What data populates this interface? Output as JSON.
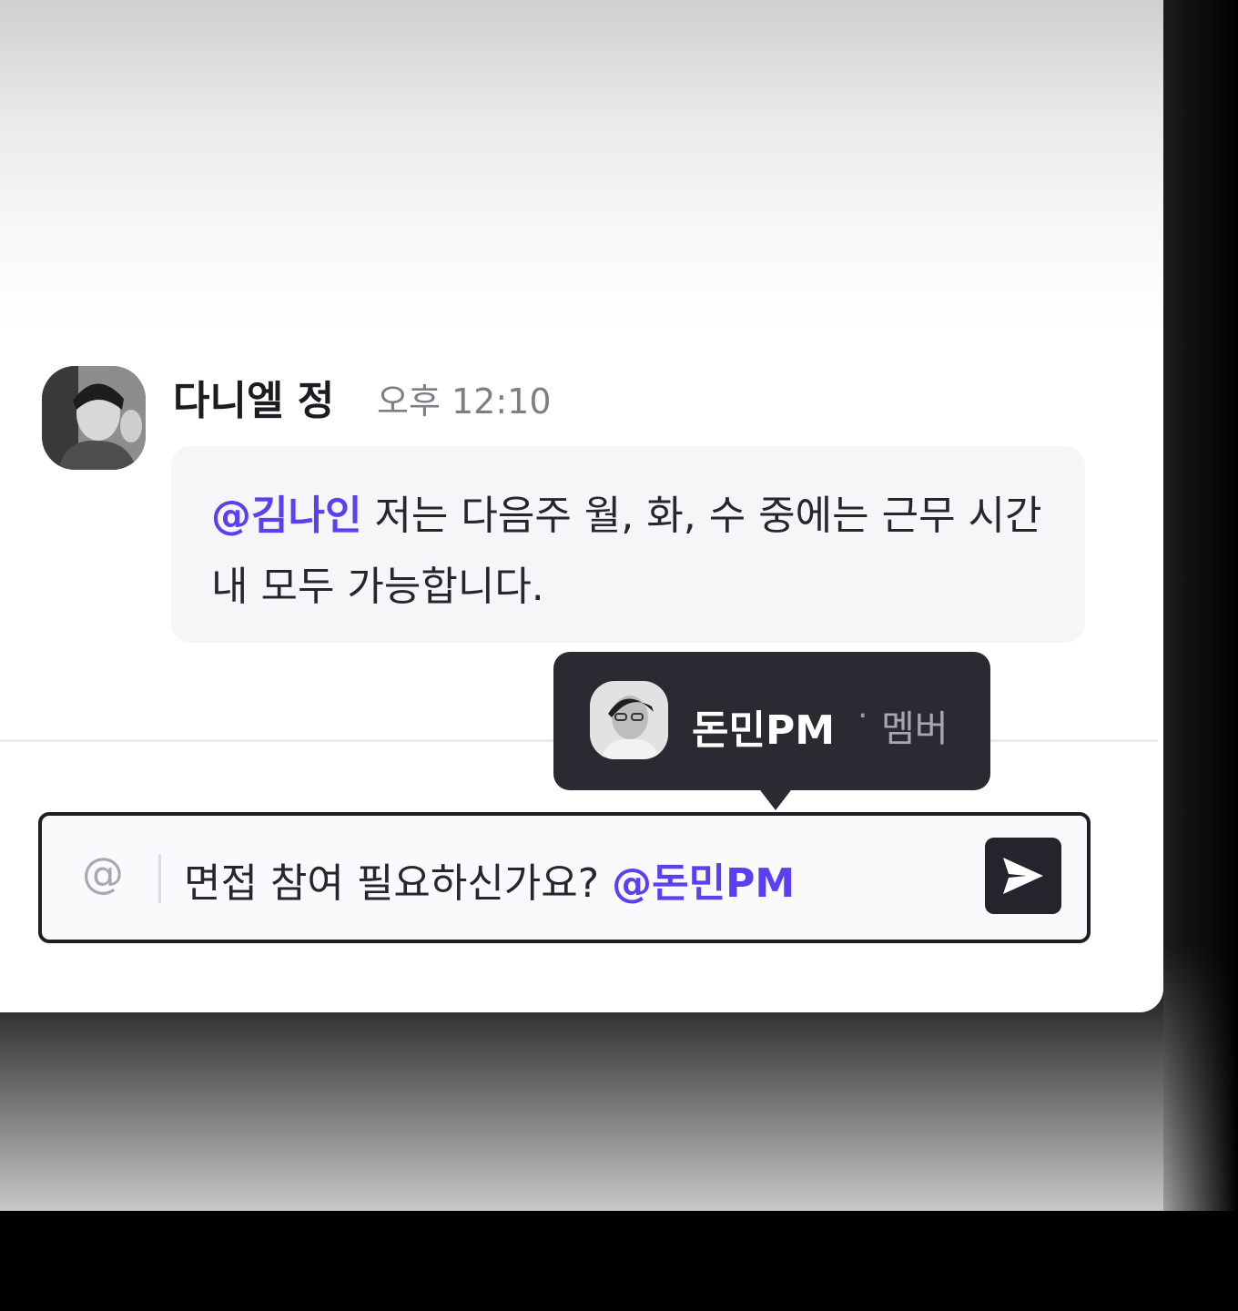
{
  "message": {
    "sender_name": "다니엘 정",
    "time": "오후 12:10",
    "mention": "@김나인",
    "body": " 저는 다음주 월, 화, 수 중에는 근무 시간 내 모두 가능합니다."
  },
  "mention_popup": {
    "name": "돈민PM",
    "separator": "·",
    "role": "멤버"
  },
  "composer": {
    "at_symbol": "@",
    "text": "면접 참여 필요하신가요? ",
    "mention": "@돈민PM"
  },
  "colors": {
    "mention": "#5b3ff0",
    "send_button": "#24242c",
    "tooltip_bg": "#2a2a32"
  },
  "icons": {
    "send": "send-arrow-icon",
    "at": "at-sign-icon"
  }
}
